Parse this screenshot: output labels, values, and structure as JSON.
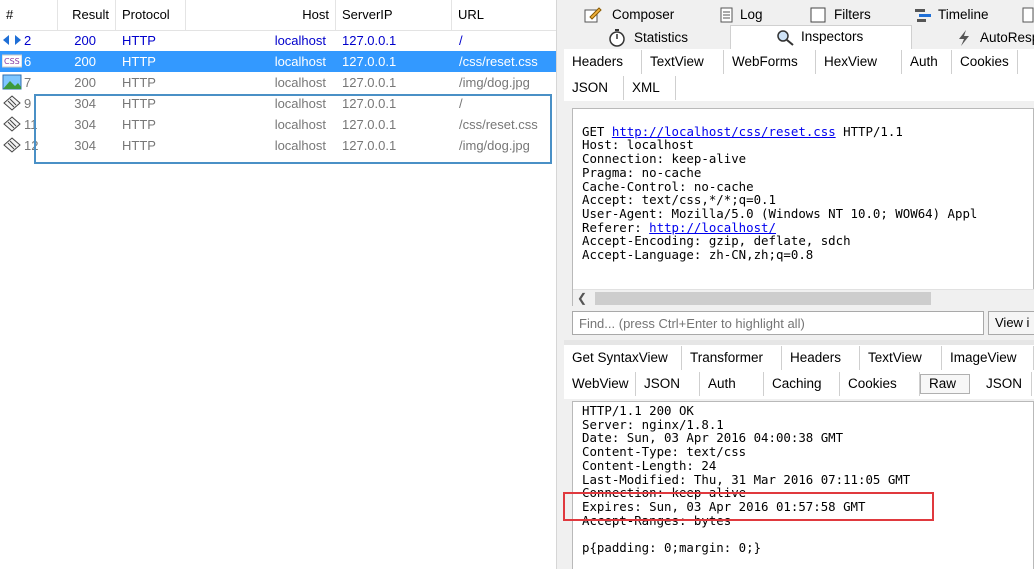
{
  "sessions": {
    "columns": [
      "#",
      "Result",
      "Protocol",
      "Host",
      "ServerIP",
      "URL"
    ],
    "rows": [
      {
        "num": "2",
        "result": "200",
        "protocol": "HTTP",
        "host": "localhost",
        "ip": "127.0.0.1",
        "url": "/",
        "icon": "arrows-icon",
        "style": "blue"
      },
      {
        "num": "6",
        "result": "200",
        "protocol": "HTTP",
        "host": "localhost",
        "ip": "127.0.0.1",
        "url": "/css/reset.css",
        "icon": "css-icon",
        "style": "selected"
      },
      {
        "num": "7",
        "result": "200",
        "protocol": "HTTP",
        "host": "localhost",
        "ip": "127.0.0.1",
        "url": "/img/dog.jpg",
        "icon": "image-icon",
        "style": "grey"
      },
      {
        "num": "9",
        "result": "304",
        "protocol": "HTTP",
        "host": "localhost",
        "ip": "127.0.0.1",
        "url": "/",
        "icon": "diamond-icon",
        "style": "grey"
      },
      {
        "num": "11",
        "result": "304",
        "protocol": "HTTP",
        "host": "localhost",
        "ip": "127.0.0.1",
        "url": "/css/reset.css",
        "icon": "diamond-icon",
        "style": "grey"
      },
      {
        "num": "12",
        "result": "304",
        "protocol": "HTTP",
        "host": "localhost",
        "ip": "127.0.0.1",
        "url": "/img/dog.jpg",
        "icon": "diamond-icon",
        "style": "grey"
      }
    ]
  },
  "toptabs": {
    "composer": "Composer",
    "log": "Log",
    "filters": "Filters",
    "timeline": "Timeline",
    "statistics": "Statistics",
    "inspectors": "Inspectors",
    "autoresp": "AutoResp"
  },
  "request_tabs": {
    "row1": [
      "Headers",
      "TextView",
      "WebForms",
      "HexView",
      "Auth",
      "Cookies"
    ],
    "row2": [
      "JSON",
      "XML"
    ]
  },
  "request": {
    "method": "GET",
    "url": "http://localhost/css/reset.css",
    "version": "HTTP/1.1",
    "lines_before_referer": [
      "Host: localhost",
      "Connection: keep-alive",
      "Pragma: no-cache",
      "Cache-Control: no-cache",
      "Accept: text/css,*/*;q=0.1",
      "User-Agent: Mozilla/5.0 (Windows NT 10.0; WOW64) Appl"
    ],
    "referer_label": "Referer:",
    "referer_url": "http://localhost/",
    "lines_after_referer": [
      "Accept-Encoding: gzip, deflate, sdch",
      "Accept-Language: zh-CN,zh;q=0.8"
    ]
  },
  "find": {
    "placeholder": "Find... (press Ctrl+Enter to highlight all)",
    "button": "View i"
  },
  "response_tabs": {
    "row1": [
      "Get SyntaxView",
      "Transformer",
      "Headers",
      "TextView",
      "ImageView"
    ],
    "row2": [
      "WebView",
      "JSON",
      "Auth",
      "Caching",
      "Cookies",
      "Raw",
      "JSON"
    ]
  },
  "response": {
    "lines": [
      "HTTP/1.1 200 OK",
      "Server: nginx/1.8.1",
      "Date: Sun, 03 Apr 2016 04:00:38 GMT",
      "Content-Type: text/css",
      "Content-Length: 24",
      "Last-Modified: Thu, 31 Mar 2016 07:11:05 GMT",
      "Connection: keep-alive",
      "Expires: Sun, 03 Apr 2016 01:57:58 GMT",
      "Accept-Ranges: bytes",
      "",
      "p{padding: 0;margin: 0;}"
    ]
  },
  "colors": {
    "selected": "#3399ff",
    "link": "#0000cc",
    "highlight_box_left": "#4a90c6",
    "highlight_box_right": "#e0393e"
  }
}
